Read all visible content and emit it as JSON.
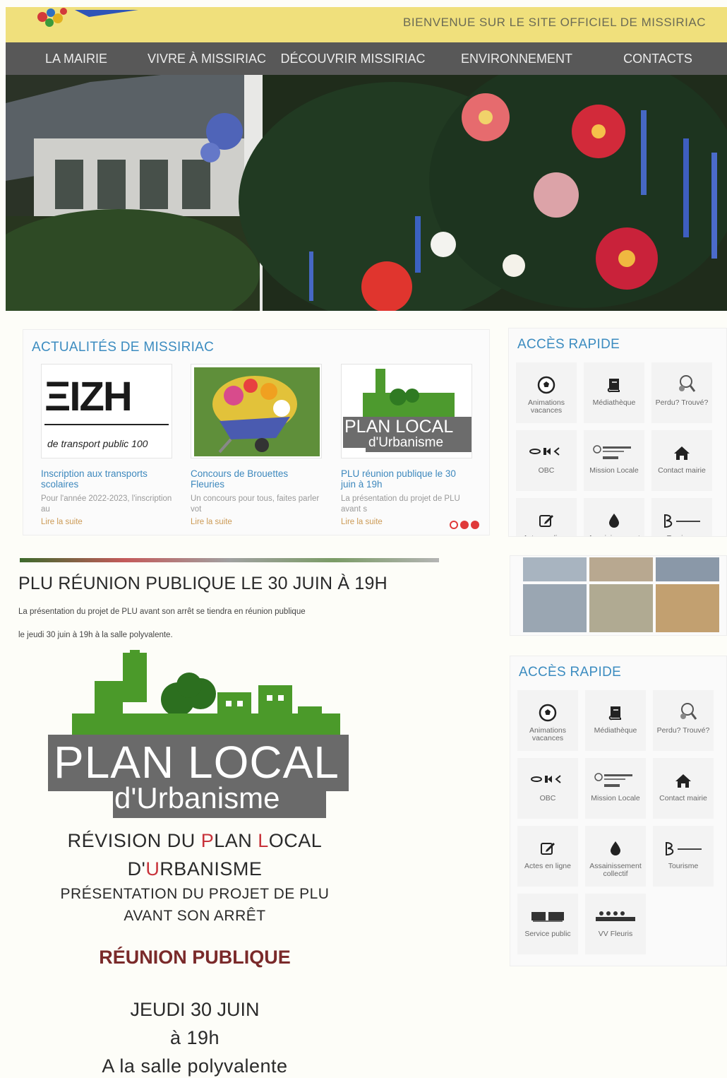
{
  "header": {
    "welcome": "BIENVENUE SUR LE SITE OFFICIEL DE MISSIRIAC"
  },
  "nav": [
    "LA MAIRIE",
    "VIVRE À MISSIRIAC",
    "DÉCOUVRIR MISSIRIAC",
    "ENVIRONNEMENT",
    "CONTACTS"
  ],
  "news": {
    "title": "ACTUALITÉS DE MISSIRIAC",
    "cards": [
      {
        "thumb_big": "ΞIZH",
        "thumb_small": "de transport public 100",
        "title": "Inscription aux transports scolaires",
        "excerpt": "Pour l'année 2022-2023, l'inscription au",
        "more": "Lire la suite"
      },
      {
        "title": "Concours de Brouettes Fleuries",
        "excerpt": "Un concours pour tous, faites parler vot",
        "more": "Lire la suite"
      },
      {
        "thumb_l1": "PLAN LOCAL",
        "thumb_l2": "d'Urbanisme",
        "title": "PLU réunion publique le 30 juin à 19h",
        "excerpt": "La présentation du projet de PLU avant s",
        "more": "Lire la suite"
      }
    ]
  },
  "quick_access": {
    "title": "ACCÈS RAPIDE",
    "tiles": [
      {
        "icon": "soccer-ball-icon",
        "label": "Animations vacances"
      },
      {
        "icon": "book-icon",
        "label": "Médiathèque"
      },
      {
        "icon": "magnifier-icon",
        "label": "Perdu? Trouvé?"
      },
      {
        "icon": "obc-logo",
        "label": "OBC"
      },
      {
        "icon": "mission-locale-logo",
        "label": "Mission Locale"
      },
      {
        "icon": "home-icon",
        "label": "Contact mairie"
      },
      {
        "icon": "edit-icon",
        "label": "Actes en ligne"
      },
      {
        "icon": "water-drop-icon",
        "label": "Assainissement collectif"
      },
      {
        "icon": "broceliande-logo",
        "label": "Tourisme"
      },
      {
        "icon": "service-public-logo",
        "label": "Service public"
      },
      {
        "icon": "villes-fleuries-logo",
        "label": "VV Fleuris"
      }
    ]
  },
  "article": {
    "title": "PLU RÉUNION PUBLIQUE LE 30 JUIN À 19H",
    "p1": "La présentation du projet de PLU avant son arrêt se tiendra en réunion publique",
    "p2": "le jeudi 30 juin à 19h à la salle polyvalente.",
    "logo_l1": "PLAN LOCAL",
    "logo_l2": "d'Urbanisme",
    "poster": {
      "l1a": "RÉVISION DU ",
      "l1b": "P",
      "l1c": "LAN ",
      "l1d": "L",
      "l1e": "OCAL",
      "l2a": "D'",
      "l2b": "U",
      "l2c": "RBANISME",
      "l3": "PRÉSENTATION DU PROJET DE PLU",
      "l4": "AVANT SON ARRÊT",
      "reunion": "RÉUNION PUBLIQUE",
      "date1": "JEUDI 30 JUIN",
      "date2": "à 19h",
      "date3": "A la salle polyvalente"
    }
  }
}
